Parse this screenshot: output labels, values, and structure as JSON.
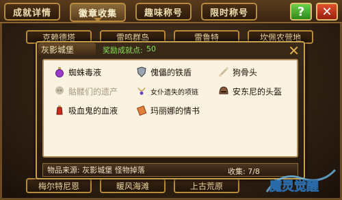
{
  "tabs": [
    {
      "label": "成就详情",
      "active": false
    },
    {
      "label": "徽章收集",
      "active": true
    },
    {
      "label": "趣味称号",
      "active": false
    },
    {
      "label": "限时称号",
      "active": false
    }
  ],
  "help_label": "?",
  "close_label": "✕",
  "background_categories": [
    "克赖德塔",
    "雷鸣群岛",
    "雷鲁特",
    "坎佩农营地"
  ],
  "bottom_categories": [
    "梅尔特尼恩",
    "暖风海滩",
    "上古荒原"
  ],
  "popup": {
    "title": "灰影城堡",
    "reward_label": "奖励成就点:",
    "reward_value": "50",
    "close_icon": "close-x-icon",
    "items": [
      {
        "label": "蜘蛛毒液",
        "icon": "purple-potion-icon",
        "dim": false
      },
      {
        "label": "傀儡的铁盾",
        "icon": "shield-icon",
        "dim": false
      },
      {
        "label": "狗骨头",
        "icon": "bone-icon",
        "dim": false
      },
      {
        "label": "骷髅们的遗产",
        "icon": "skull-relic-icon",
        "dim": true
      },
      {
        "label": "女仆遗失的项链",
        "icon": "necklace-icon",
        "dim": false
      },
      {
        "label": "安东尼的头盔",
        "icon": "helmet-icon",
        "dim": false
      },
      {
        "label": "吸血鬼的血液",
        "icon": "blood-vial-icon",
        "dim": false
      },
      {
        "label": "玛丽娜的情书",
        "icon": "scroll-letter-icon",
        "dim": false
      }
    ],
    "source_text": "物品来源: 灰影城堡 怪物掉落",
    "collect_label": "收集: 7/8"
  },
  "logo_text": "魔灵觉醒",
  "colors": {
    "accent": "#b88a3c",
    "reward": "#8ae05a",
    "panel": "#fbf3e2"
  }
}
